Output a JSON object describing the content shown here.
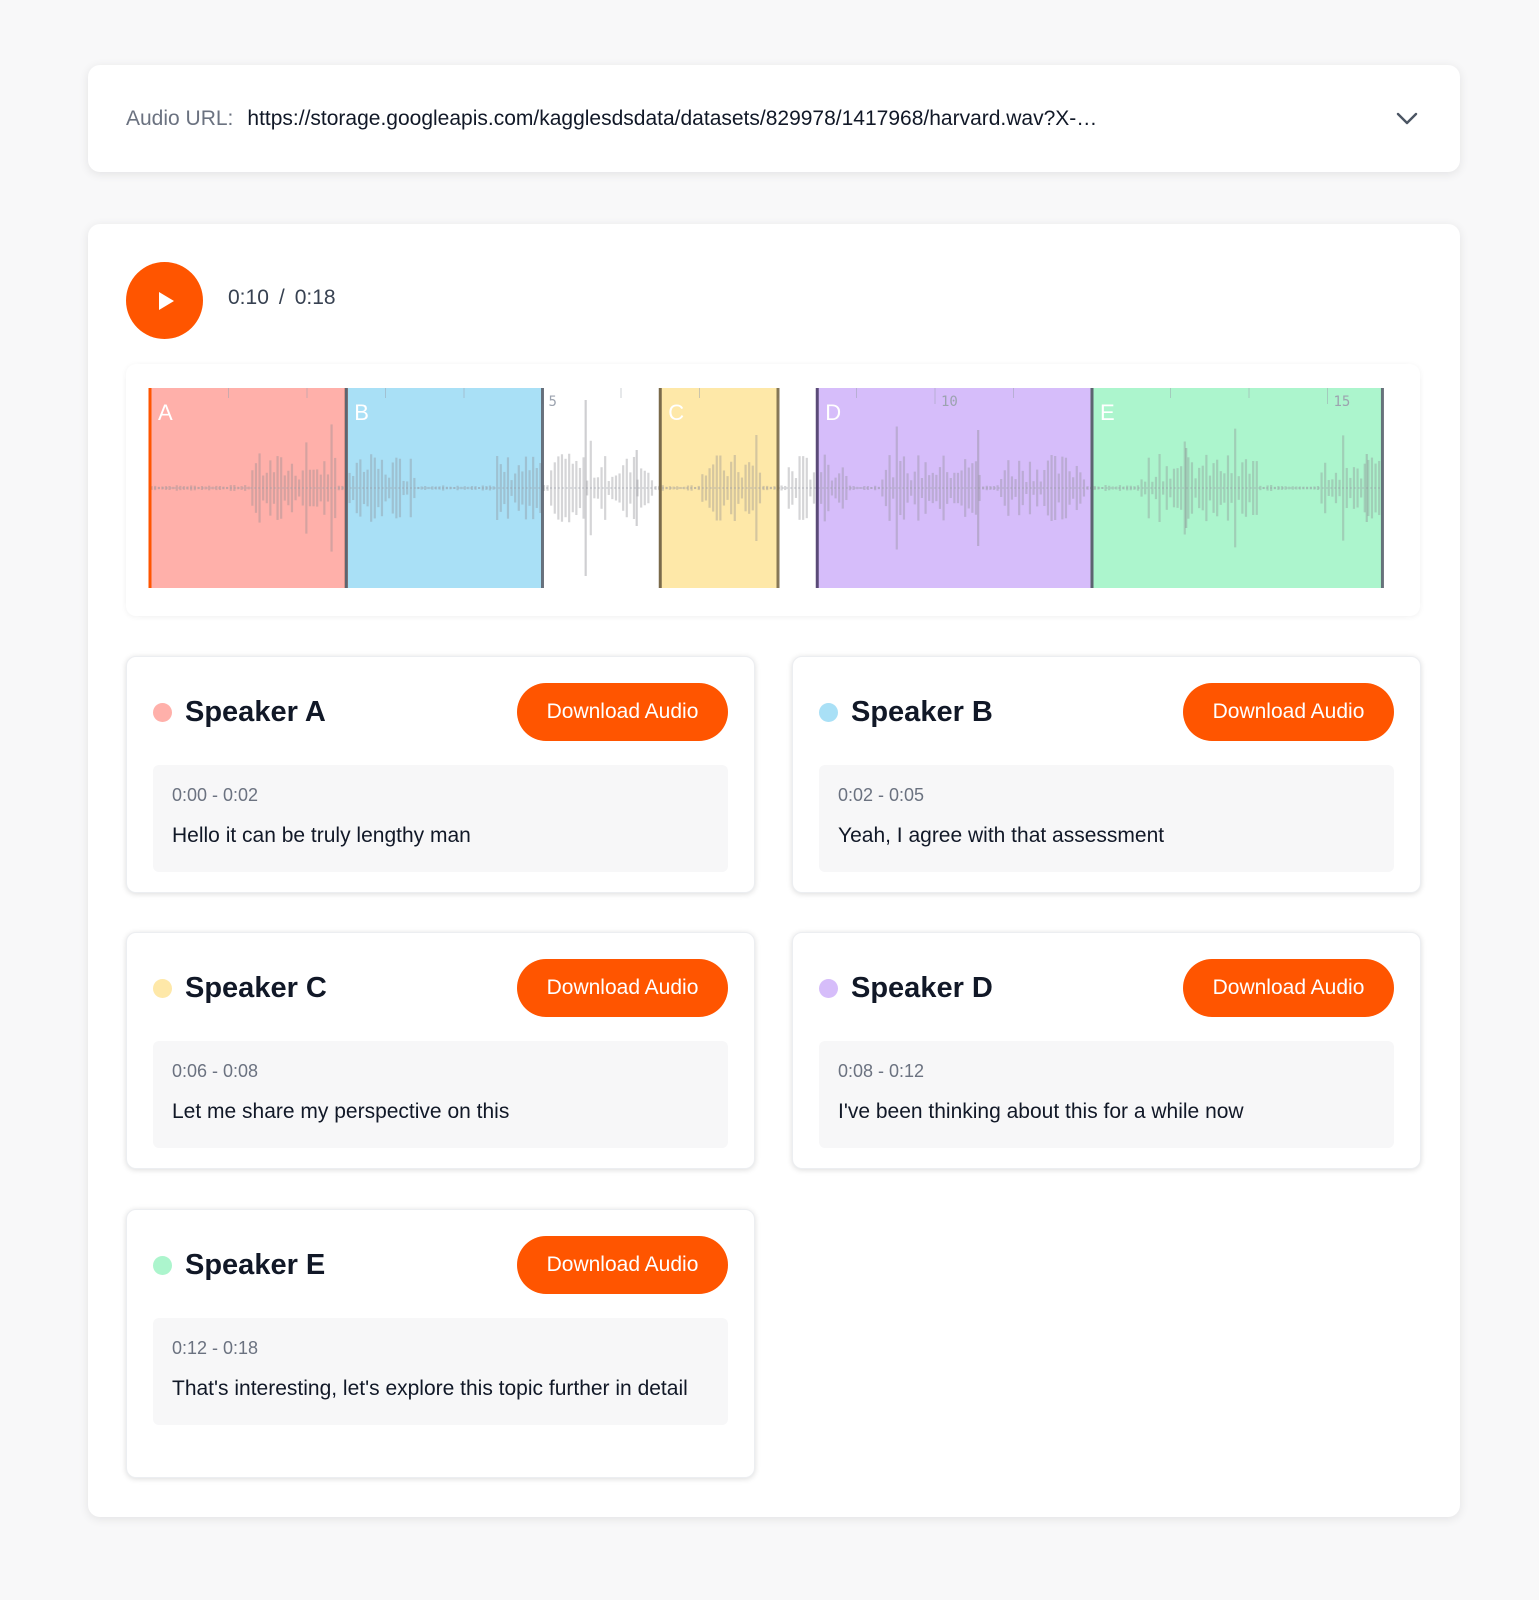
{
  "url_bar": {
    "label": "Audio URL:",
    "value": "https://storage.googleapis.com/kagglesdsdata/datasets/829978/1417968/harvard.wav?X-…"
  },
  "player": {
    "current_time": "0:10",
    "separator": "/",
    "duration": "0:18",
    "total_seconds": 18,
    "timeline_ticks": [
      "5",
      "10",
      "15"
    ],
    "regions": [
      {
        "label": "A",
        "start": 0.0,
        "end": 2.5,
        "fill": "#ffb0aa",
        "edge": "#ff5500"
      },
      {
        "label": "B",
        "start": 2.5,
        "end": 5.0,
        "fill": "#a9e0f6",
        "edge": "#5c6470"
      },
      {
        "label": "C",
        "start": 6.5,
        "end": 8.0,
        "fill": "#fee8a8",
        "edge": "#7a6a4a"
      },
      {
        "label": "D",
        "start": 8.5,
        "end": 12.0,
        "fill": "#d6bdfa",
        "edge": "#5a4a78"
      },
      {
        "label": "E",
        "start": 12.0,
        "end": 15.7,
        "fill": "#acf5cd",
        "edge": "#5c6470"
      }
    ]
  },
  "speakers": [
    {
      "name": "Speaker A",
      "color": "#ffb0aa",
      "button": "Download Audio",
      "time": "0:00 - 0:02",
      "text": "Hello it can be truly lengthy man"
    },
    {
      "name": "Speaker B",
      "color": "#a9e0f6",
      "button": "Download Audio",
      "time": "0:02 - 0:05",
      "text": "Yeah, I agree with that assessment"
    },
    {
      "name": "Speaker C",
      "color": "#fee8a8",
      "button": "Download Audio",
      "time": "0:06 - 0:08",
      "text": "Let me share my perspective on this"
    },
    {
      "name": "Speaker D",
      "color": "#d6bdfa",
      "button": "Download Audio",
      "time": "0:08 - 0:12",
      "text": "I've been thinking about this for a while now"
    },
    {
      "name": "Speaker E",
      "color": "#acf5cd",
      "button": "Download Audio",
      "time": "0:12 - 0:18",
      "text": "That's interesting, let's explore this topic further in detail"
    }
  ]
}
